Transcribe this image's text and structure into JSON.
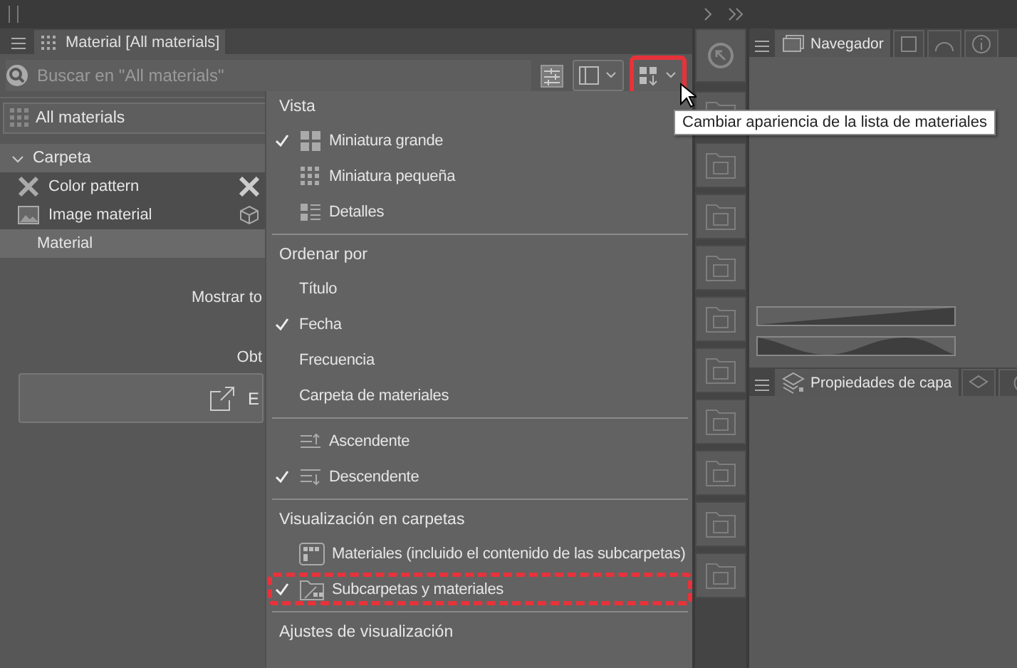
{
  "material_panel": {
    "tab": "Material [All materials]",
    "search": {
      "placeholder": "Buscar en \"All materials\""
    },
    "toolbar": [
      {
        "highlighted": false
      },
      {
        "highlighted": false
      },
      {
        "highlighted": true
      }
    ],
    "location": "All materials",
    "folder": {
      "label": "Carpeta",
      "expanded": true,
      "items": [
        {
          "label": "Color pattern",
          "selected": false
        },
        {
          "label": "Image material",
          "selected": false
        },
        {
          "label": "Material",
          "selected": true
        }
      ]
    },
    "notes": [
      "Mostrar to",
      "Obt"
    ],
    "button": "E"
  },
  "menu": {
    "sections": [
      {
        "title": "Vista",
        "items": [
          {
            "label": "Miniatura grande",
            "checked": true,
            "highlighted": false
          },
          {
            "label": "Miniatura pequeña",
            "checked": false,
            "highlighted": false
          },
          {
            "label": "Detalles",
            "checked": false,
            "highlighted": false
          }
        ]
      },
      {
        "title": "Ordenar por",
        "items": [
          {
            "label": "Título",
            "checked": false,
            "highlighted": false
          },
          {
            "label": "Fecha",
            "checked": true,
            "highlighted": false
          },
          {
            "label": "Frecuencia",
            "checked": false,
            "highlighted": false
          },
          {
            "label": "Carpeta de materiales",
            "checked": false,
            "highlighted": false
          }
        ]
      },
      {
        "items": [
          {
            "label": "Ascendente",
            "checked": false,
            "highlighted": false
          },
          {
            "label": "Descendente",
            "checked": true,
            "highlighted": false
          }
        ]
      },
      {
        "title": "Visualización en carpetas",
        "items": [
          {
            "label": "Materiales (incluido el contenido de las subcarpetas)",
            "checked": false,
            "highlighted": false
          },
          {
            "label": "Subcarpetas y materiales",
            "checked": true,
            "highlighted": true
          }
        ]
      },
      {
        "title": "Ajustes de visualización"
      }
    ]
  },
  "tooltip": "Cambiar apariencia de la lista de materiales",
  "navigator": {
    "tabs": [
      {
        "label": "Navegador",
        "selected": true
      },
      {
        "selected": false
      },
      {
        "selected": false
      },
      {
        "selected": false
      }
    ]
  },
  "layer_panel": {
    "tabs": [
      {
        "label": "Propiedades de capa",
        "selected": true
      },
      {
        "selected": false
      },
      {
        "selected": false
      }
    ]
  }
}
